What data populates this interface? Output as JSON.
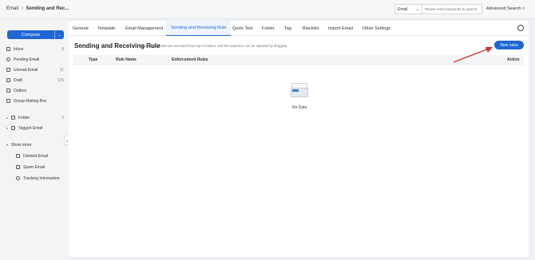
{
  "topbar": {
    "breadcrumb_root": "Email",
    "breadcrumb_sep": ">",
    "breadcrumb_current": "Sending and Rec...",
    "search_scope": "Email",
    "search_placeholder": "Please enter keywords to search",
    "advanced_search": "Advanced Search",
    "advanced_icon": "chevron-up-icon"
  },
  "sidebar": {
    "compose_label": "Compose",
    "compose_dropdown": "⌄",
    "items": [
      {
        "label": "Inbox",
        "count": "8",
        "icon": "inbox-icon"
      },
      {
        "label": "Pending Email",
        "count": "",
        "icon": "clock-icon"
      },
      {
        "label": "Unread Email",
        "count": "11",
        "icon": "unread-mail-icon"
      },
      {
        "label": "Draft",
        "count": "105",
        "icon": "draft-icon"
      },
      {
        "label": "Outbox",
        "count": "",
        "icon": "outbox-icon"
      },
      {
        "label": "Group Mailing Box",
        "count": "",
        "icon": "group-mail-icon"
      }
    ],
    "folder": {
      "label": "Folder",
      "count": "3"
    },
    "tagged": {
      "label": "Tagged Email",
      "count": ""
    },
    "show_more": "Show more",
    "more_items": [
      {
        "label": "Deleted Email",
        "icon": "trash-icon"
      },
      {
        "label": "Spam Email",
        "icon": "spam-icon"
      },
      {
        "label": "Tracking Information",
        "icon": "tracking-icon"
      }
    ],
    "collapse_glyph": "◂"
  },
  "tabs": [
    "General",
    "Template",
    "Email Management",
    "Sending and Receiving Rule",
    "Quick Text",
    "Folder",
    "Tag",
    "Blacklist",
    "Import Email",
    "Other Settings"
  ],
  "active_tab_index": 3,
  "content": {
    "title": "Sending and Receiving Rule",
    "description": "Email receipt rules are executed from top to bottom, and the sequence can be adjusted by dragging",
    "new_rules_button": "New rules",
    "columns": {
      "type": "Type",
      "rule_name": "Rule Name",
      "enforcement": "Enforcement Rules",
      "action": "Action"
    },
    "empty_text": "No Data"
  },
  "colors": {
    "accent": "#1e66d4",
    "annotation_arrow": "#d0312d"
  }
}
